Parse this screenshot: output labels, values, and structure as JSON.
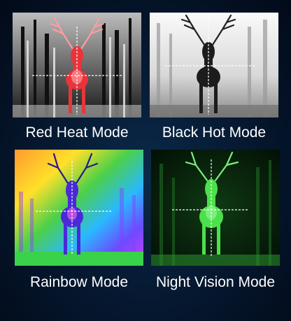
{
  "modes": [
    {
      "label": "Red Heat Mode"
    },
    {
      "label": "Black Hot Mode"
    },
    {
      "label": "Rainbow Mode"
    },
    {
      "label": "Night Vision Mode"
    }
  ],
  "colors": {
    "background": "#061a33",
    "red_heat_deer": "#e8343a",
    "night_vision": "#4ce04c",
    "caption": "#ffffff"
  }
}
